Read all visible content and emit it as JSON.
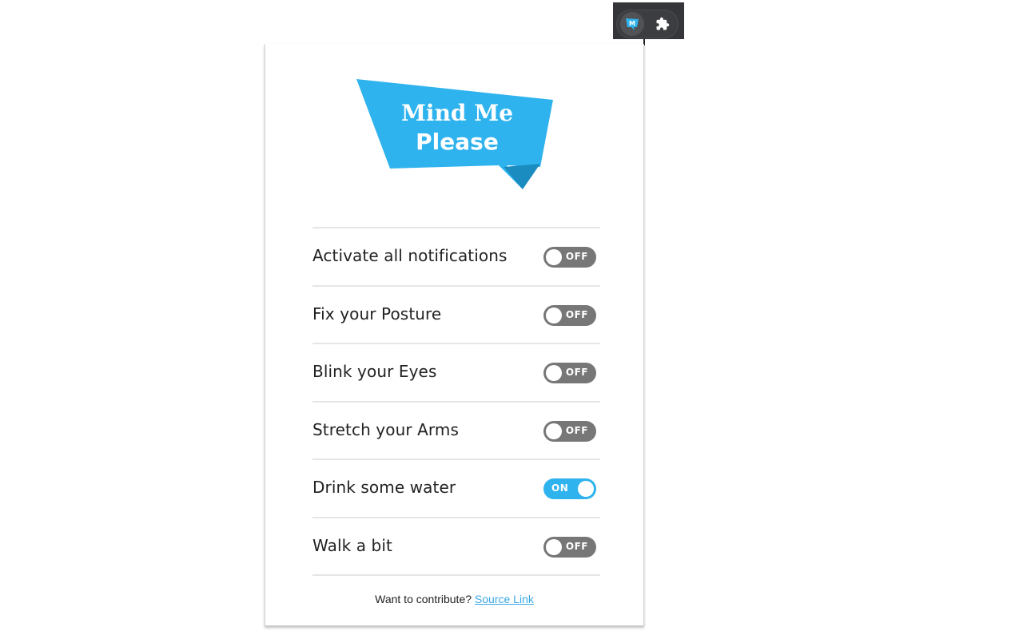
{
  "browser_toolbar": {
    "extensions": [
      {
        "name": "Mind Me Please",
        "icon": "mind-me-please-icon",
        "glyph": "M"
      },
      {
        "name": "Extensions",
        "icon": "puzzle-icon"
      }
    ]
  },
  "popup": {
    "logo": {
      "line1": "Mind Me",
      "line2": "Please",
      "color": "#2fb3ee",
      "fold_color": "#1a8cbf"
    },
    "settings": [
      {
        "label": "Activate all notifications",
        "state": "OFF"
      },
      {
        "label": "Fix your Posture",
        "state": "OFF"
      },
      {
        "label": "Blink your Eyes",
        "state": "OFF"
      },
      {
        "label": "Stretch your Arms",
        "state": "OFF"
      },
      {
        "label": "Drink some water",
        "state": "ON"
      },
      {
        "label": "Walk a bit",
        "state": "OFF"
      }
    ],
    "footer": {
      "text": "Want to contribute?",
      "link_label": "Source Link"
    },
    "colors": {
      "on": "#2fb3ee",
      "off": "#777777"
    }
  }
}
